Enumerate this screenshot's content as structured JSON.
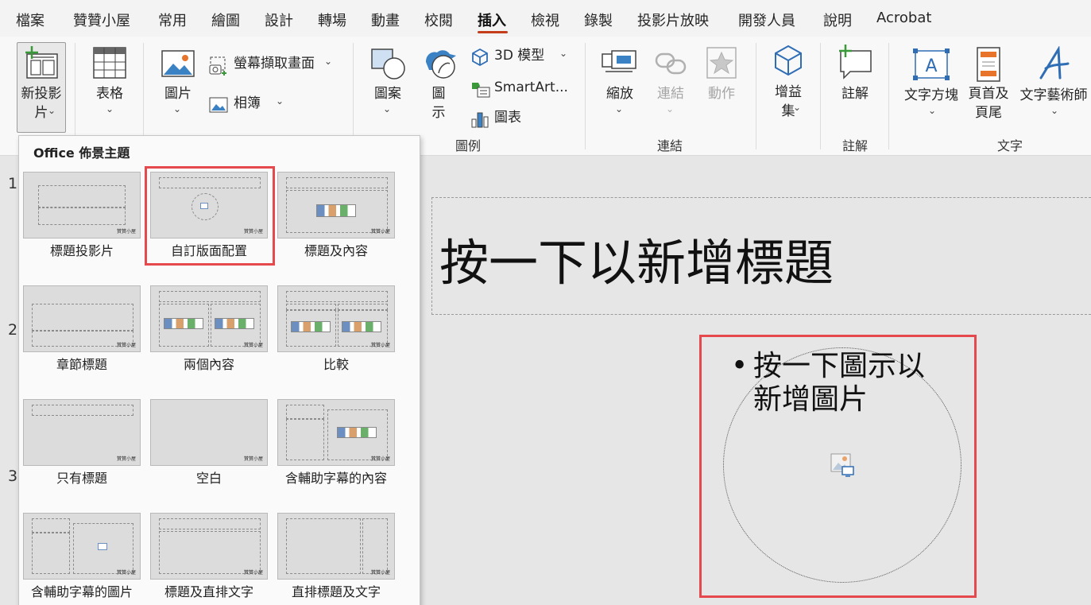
{
  "menu": {
    "items": [
      "檔案",
      "贊贊小屋",
      "常用",
      "繪圖",
      "設計",
      "轉場",
      "動畫",
      "校閱",
      "插入",
      "檢視",
      "錄製",
      "投影片放映",
      "開發人員",
      "說明",
      "Acrobat"
    ],
    "active": "插入"
  },
  "ribbon": {
    "new_slide": "新投影\n片",
    "table": "表格",
    "picture": "圖片",
    "screenshot": "螢幕擷取畫面",
    "album": "相簿",
    "shapes": "圖案",
    "icons": "圖\n示",
    "model3d": "3D 模型",
    "smartart": "SmartArt...",
    "chart": "圖表",
    "zoom": "縮放",
    "link": "連結",
    "action": "動作",
    "addins": "增益\n集",
    "comment": "註解",
    "textbox": "文字方塊",
    "header_footer": "頁首及\n頁尾",
    "wordart": "文字藝術師",
    "groups": {
      "illustrations": "圖例",
      "links": "連結",
      "comments": "註解",
      "text": "文字"
    }
  },
  "gallery": {
    "title": "Office 佈景主題",
    "logo_text": "贊贊小屋",
    "layouts": [
      "標題投影片",
      "自訂版面配置",
      "標題及內容",
      "章節標題",
      "兩個內容",
      "比較",
      "只有標題",
      "空白",
      "含輔助字幕的內容",
      "含輔助字幕的圖片",
      "標題及直排文字",
      "直排標題及文字"
    ],
    "highlighted": "自訂版面配置"
  },
  "thumbnails": {
    "numbers": [
      "1",
      "2",
      "3"
    ]
  },
  "slide": {
    "title_placeholder": "按一下以新增標題",
    "bullet": "•",
    "content_line1": "按一下圖示以",
    "content_line2": "新增圖片"
  },
  "colors": {
    "highlight": "#e5484d",
    "active_tab_underline": "#c43e1c",
    "icon_blue": "#2f6db5",
    "icon_orange": "#e8742c"
  }
}
